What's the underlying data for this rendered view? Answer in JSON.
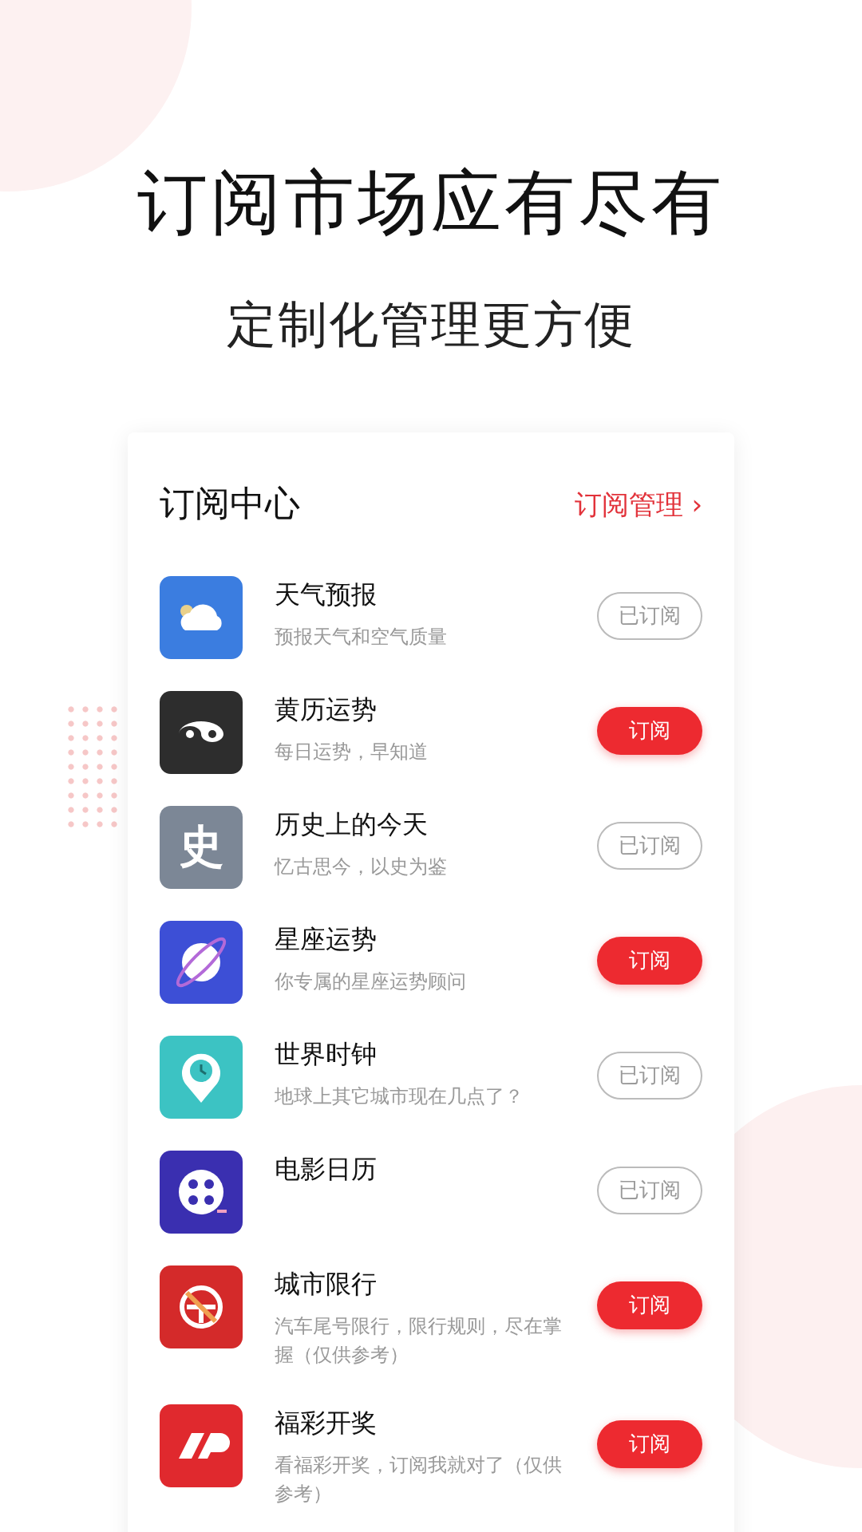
{
  "headline": "订阅市场应有尽有",
  "subheadline": "定制化管理更方便",
  "card": {
    "title": "订阅中心",
    "manage_link": "订阅管理 ›",
    "items": [
      {
        "kind": "weather",
        "title": "天气预报",
        "desc": "预报天气和空气质量",
        "subscribed": true,
        "button": "已订阅"
      },
      {
        "kind": "yinyang",
        "title": "黄历运势",
        "desc": "每日运势，早知道",
        "subscribed": false,
        "button": "订阅"
      },
      {
        "kind": "glyph",
        "icon_text": "史",
        "title": "历史上的今天",
        "desc": "忆古思今，以史为鉴",
        "subscribed": true,
        "button": "已订阅"
      },
      {
        "kind": "planet",
        "title": "星座运势",
        "desc": "你专属的星座运势顾问",
        "subscribed": false,
        "button": "订阅"
      },
      {
        "kind": "clock",
        "title": "世界时钟",
        "desc": "地球上其它城市现在几点了？",
        "subscribed": true,
        "button": "已订阅"
      },
      {
        "kind": "film",
        "title": "电影日历",
        "subscribed": true,
        "button": "已订阅"
      },
      {
        "kind": "noentry",
        "title": "城市限行",
        "desc": "汽车尾号限行，限行规则，尽在掌握（仅供参考）",
        "subscribed": false,
        "button": "订阅"
      },
      {
        "kind": "lottery",
        "title": "福彩开奖",
        "desc": "看福彩开奖，订阅我就对了（仅供参考）",
        "subscribed": false,
        "button": "订阅"
      }
    ]
  }
}
